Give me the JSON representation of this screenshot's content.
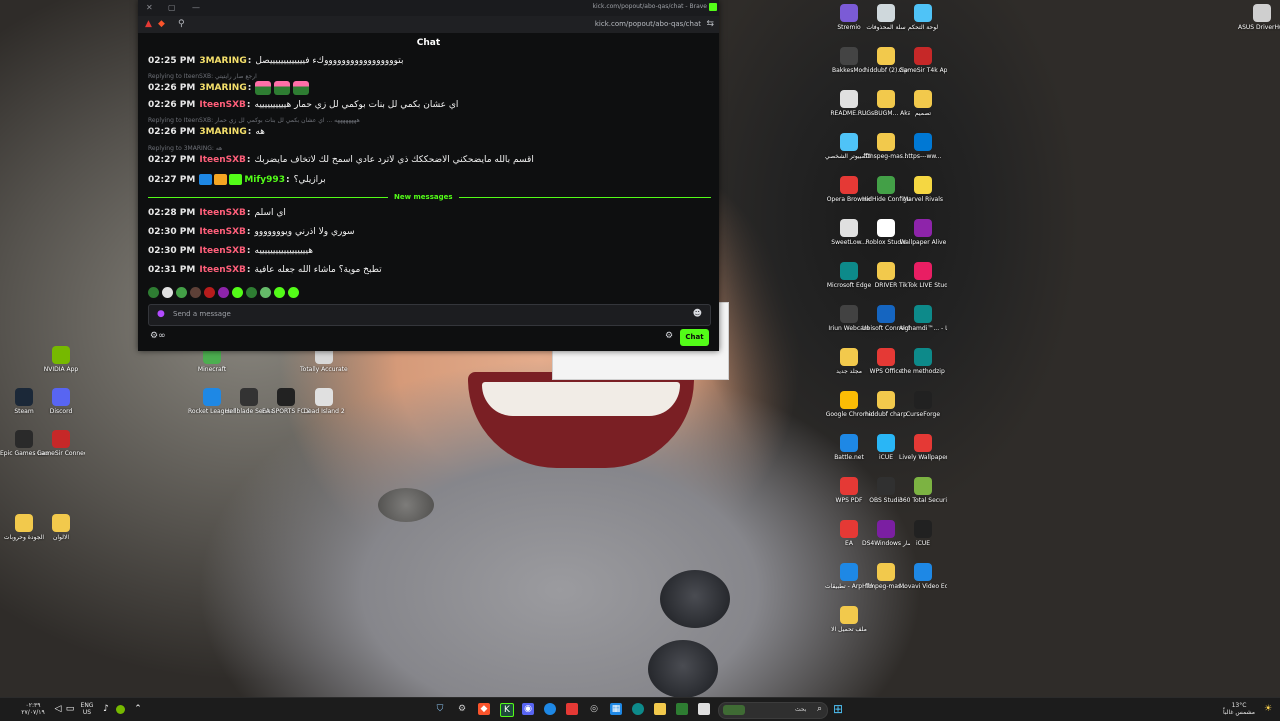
{
  "browser": {
    "window_title": "kick.com/popout/abo-qas/chat - Brave",
    "url": "kick.com/popout/abo-qas/chat"
  },
  "chat": {
    "header": "Chat",
    "messages": [
      {
        "time": "02:25 PM",
        "user": "3MARING",
        "user_color": "#f5e06b",
        "text": "بتوووووووووووووووووكء فيييييييييييييصل"
      },
      {
        "reply": "Replying to IteenSXB: ارجع صار رايتيتي"
      },
      {
        "time": "02:26 PM",
        "user": "3MARING",
        "user_color": "#f5e06b",
        "text": "",
        "emotes": 3
      },
      {
        "time": "02:26 PM",
        "user": "IteenSXB",
        "user_color": "#ff5f7a",
        "text": "اي عشان بكمي لل بنات بوكمي لل زي حمار هييييييييييه"
      },
      {
        "reply": "Replying to IteenSXB: ههههههههه ... اي عشان بكمي لل بنات بوكمي لل زي حمار"
      },
      {
        "time": "02:26 PM",
        "user": "3MARING",
        "user_color": "#f5e06b",
        "text": "هه"
      },
      {
        "reply": "Replying to 3MARING: هه"
      },
      {
        "time": "02:27 PM",
        "user": "IteenSXB",
        "user_color": "#ff5f7a",
        "text": "اقسم بالله مايضحكني الاضحككك ذي لاترد عادي اسمح لك لاتخاف مايضربك"
      },
      {
        "time": "02:27 PM",
        "user": "Mify993",
        "user_color": "#53fc18",
        "text": "برازيلي؟",
        "badges": 3
      },
      {
        "time": "02:28 PM",
        "user": "IteenSXB",
        "user_color": "#ff5f7a",
        "text": "اي اسلم"
      },
      {
        "time": "02:30 PM",
        "user": "IteenSXB",
        "user_color": "#ff5f7a",
        "text": "سوري ولا اذرني ويووووووو"
      },
      {
        "time": "02:30 PM",
        "user": "IteenSXB",
        "user_color": "#ff5f7a",
        "text": "هييييييييييييييييييه"
      },
      {
        "time": "02:31 PM",
        "user": "IteenSXB",
        "user_color": "#ff5f7a",
        "text": "تطبخ موية؟ ماشاء الله جعله عافية"
      }
    ],
    "new_messages_label": "New messages",
    "input_placeholder": "Send a message",
    "send_button": "Chat"
  },
  "desktop_icons_left": [
    {
      "label": "NVIDIA App",
      "color": "#76b900"
    },
    {
      "label": "Steam",
      "color": "#1b2838"
    },
    {
      "label": "Discord",
      "color": "#5865f2"
    },
    {
      "label": "Epic Games Launcher",
      "color": "#2a2a2a"
    },
    {
      "label": "GameSir Connect",
      "color": "#c62828"
    },
    {
      "label": "الجودة وحروبات",
      "color": "#f2c94c"
    },
    {
      "label": "الالوان",
      "color": "#f2c94c"
    },
    {
      "label": "Minecraft",
      "color": "#4caf50"
    },
    {
      "label": "Totally Accurate...",
      "color": "#d8d8d8"
    },
    {
      "label": "Rocket League®",
      "color": "#1e88e5"
    },
    {
      "label": "Hellblade Senua's...",
      "color": "#333333"
    },
    {
      "label": "EA SPORTS FC 26",
      "color": "#222222"
    },
    {
      "label": "Dead Island 2",
      "color": "#e0e0e0"
    }
  ],
  "desktop_icons_right": [
    {
      "label": "Stremio",
      "color": "#7b5bd6"
    },
    {
      "label": "سلة المحذوفات",
      "color": "#cfd8dc"
    },
    {
      "label": "لوحة التحكم",
      "color": "#4fc3f7"
    },
    {
      "label": "ASUS DriverHub",
      "color": "#cfcfcf"
    },
    {
      "label": "BakkesMod",
      "color": "#444444"
    },
    {
      "label": "hiddubf (2).zip",
      "color": "#f2c94c"
    },
    {
      "label": "GameSir T4k App",
      "color": "#c62828"
    },
    {
      "label": "README.R...",
      "color": "#e0e0e0"
    },
    {
      "label": "UGsBUGM... Akara - GLS...",
      "color": "#f2c94c"
    },
    {
      "label": "تصميم",
      "color": "#f2c94c"
    },
    {
      "label": "هذا الكمبيوتر الشخصي",
      "color": "#4fc3f7"
    },
    {
      "label": "fftnspeg-mas...",
      "color": "#f2c94c"
    },
    {
      "label": "https---ww...",
      "color": "#0078d4"
    },
    {
      "label": "Opera Browser",
      "color": "#e53935"
    },
    {
      "label": "HidHide Configurat...",
      "color": "#43a047"
    },
    {
      "label": "Marvel Rivals",
      "color": "#f5d742"
    },
    {
      "label": "SweetLow...",
      "color": "#e0e0e0"
    },
    {
      "label": "Roblox Studio",
      "color": "#ffffff"
    },
    {
      "label": "Wallpaper Alive",
      "color": "#8e24aa"
    },
    {
      "label": "Microsoft Edge",
      "color": "#0d8a8a"
    },
    {
      "label": "DRIVER",
      "color": "#f2c94c"
    },
    {
      "label": "TikTok LIVE Studio",
      "color": "#e91e63"
    },
    {
      "label": "Iriun Webcam",
      "color": "#424242"
    },
    {
      "label": "Ubisoft Connect",
      "color": "#1565c0"
    },
    {
      "label": "Alghamdi™... - الله اكبر لعبتنا",
      "color": "#0d8a8a"
    },
    {
      "label": "مجلد جديد",
      "color": "#f2c94c"
    },
    {
      "label": "WPS Office",
      "color": "#e53935"
    },
    {
      "label": "the methodzip",
      "color": "#0d8a8a"
    },
    {
      "label": "Google Chrome",
      "color": "#fbbc05"
    },
    {
      "label": "hiddubf charp",
      "color": "#f2c94c"
    },
    {
      "label": "CurseForge",
      "color": "#212121"
    },
    {
      "label": "Battle.net",
      "color": "#1e88e5"
    },
    {
      "label": "iCUE",
      "color": "#29b6f6"
    },
    {
      "label": "Lively Wallpaper",
      "color": "#e53935"
    },
    {
      "label": "WPS PDF",
      "color": "#e53935"
    },
    {
      "label": "OBS Studio",
      "color": "#303030"
    },
    {
      "label": "360 Total Security",
      "color": "#7cb342"
    },
    {
      "label": "EA",
      "color": "#e53935"
    },
    {
      "label": "DS4Windows اختصار",
      "color": "#7b1fa2"
    },
    {
      "label": "iCUE",
      "color": "#212121"
    },
    {
      "label": "تطبيقات - ArpHidd...",
      "color": "#1e88e5"
    },
    {
      "label": "ffmpeg-mas...",
      "color": "#f2c94c"
    },
    {
      "label": "Movavi Video Edit...",
      "color": "#1e88e5"
    },
    {
      "label": "ملف تحميل آلا",
      "color": "#f2c94c"
    }
  ],
  "taskbar": {
    "time": "٠٢:٣٩",
    "date": "٢٧/٠٧/١٩",
    "language": "ENG",
    "region": "US",
    "weather_temp": "13°C",
    "weather_desc": "مشمس غالباً",
    "search_text": "بحث"
  }
}
